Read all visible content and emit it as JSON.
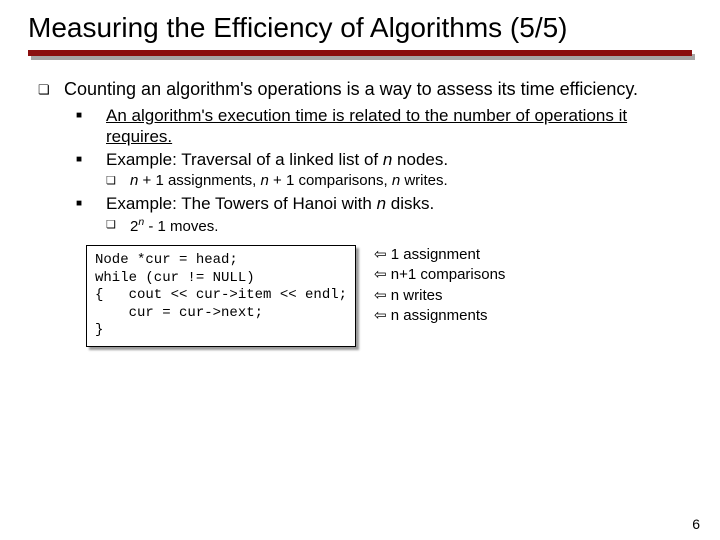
{
  "title": "Measuring the Efficiency of Algorithms (5/5)",
  "main_point": "Counting an algorithm's operations is a way to assess its time efficiency.",
  "sub1": "An algorithm's execution time is related to the number of operations it requires.",
  "sub2_prefix": "Example: Traversal of a linked list of ",
  "sub2_n": "n",
  "sub2_suffix": " nodes.",
  "sub2_detail_a": "n",
  "sub2_detail_b": " + 1 assignments, ",
  "sub2_detail_c": "n",
  "sub2_detail_d": " + 1 comparisons, ",
  "sub2_detail_e": "n",
  "sub2_detail_f": " writes.",
  "sub3_prefix": "Example: The Towers of Hanoi with ",
  "sub3_n": "n",
  "sub3_suffix": " disks.",
  "sub3_detail_base": "2",
  "sub3_detail_exp": "n",
  "sub3_detail_rest": " - 1 moves.",
  "code": "Node *cur = head;\nwhile (cur != NULL)\n{   cout << cur->item << endl;\n    cur = cur->next;\n}",
  "annotations": [
    "⇦ 1 assignment",
    "⇦ n+1 comparisons",
    "⇦ n writes",
    "⇦ n assignments"
  ],
  "page_number": "6"
}
